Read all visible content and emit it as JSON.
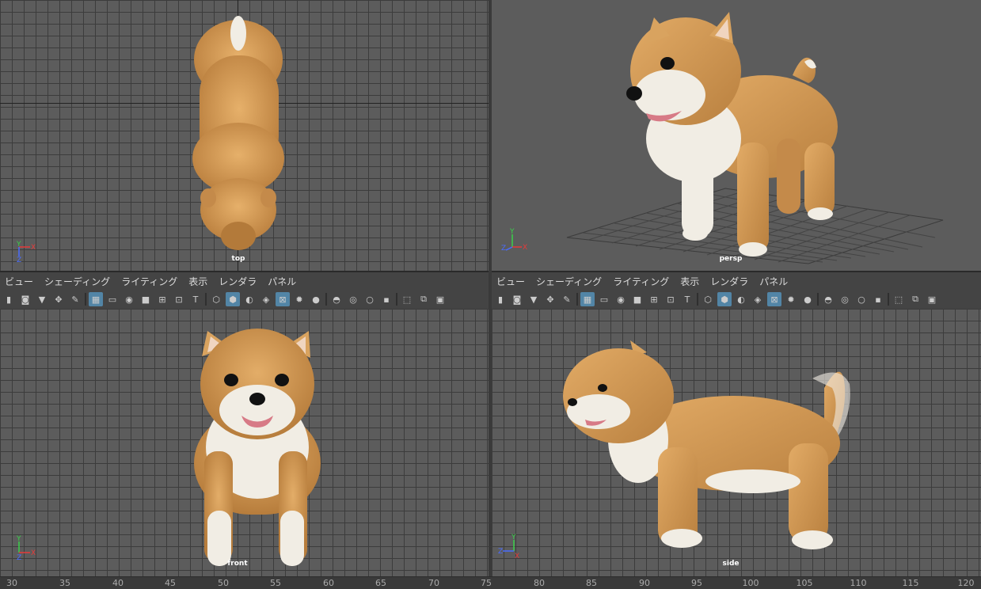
{
  "viewports": {
    "top": {
      "label": "top"
    },
    "persp": {
      "label": "persp"
    },
    "front": {
      "label": "front"
    },
    "side": {
      "label": "side"
    }
  },
  "panel_menu": [
    "ビュー",
    "シェーディング",
    "ライティング",
    "表示",
    "レンダラ",
    "パネル"
  ],
  "gizmo_axes": {
    "x": "X",
    "y": "Y",
    "z": "Z"
  },
  "timeline_ticks": [
    "30",
    "35",
    "40",
    "45",
    "50",
    "55",
    "60",
    "65",
    "70",
    "75",
    "80",
    "85",
    "90",
    "95",
    "100",
    "105",
    "110",
    "115",
    "120"
  ],
  "colors": {
    "fur": "#d9a35f",
    "fur_dark": "#c58a47",
    "white_fur": "#f1ede4",
    "viewport_bg": "#5c5c5c",
    "grid": "#3c3c3c",
    "toolbar_active": "#5285a6",
    "axis_x": "#e63a3a",
    "axis_y": "#3ad04a",
    "axis_z": "#4a6cff"
  },
  "icons": [
    "camera-icon",
    "film-icon",
    "bookmark-icon",
    "image-plane-icon",
    "pencil-icon",
    "grid-icon",
    "film-gate-icon",
    "resolution-gate-icon",
    "safe-action-icon",
    "field-chart-icon",
    "safe-title-icon",
    "wireframe-cube-icon",
    "smooth-cube-icon",
    "lights-icon",
    "shadows-icon",
    "xray-icon",
    "isolate-icon",
    "camera-attr-icon"
  ]
}
